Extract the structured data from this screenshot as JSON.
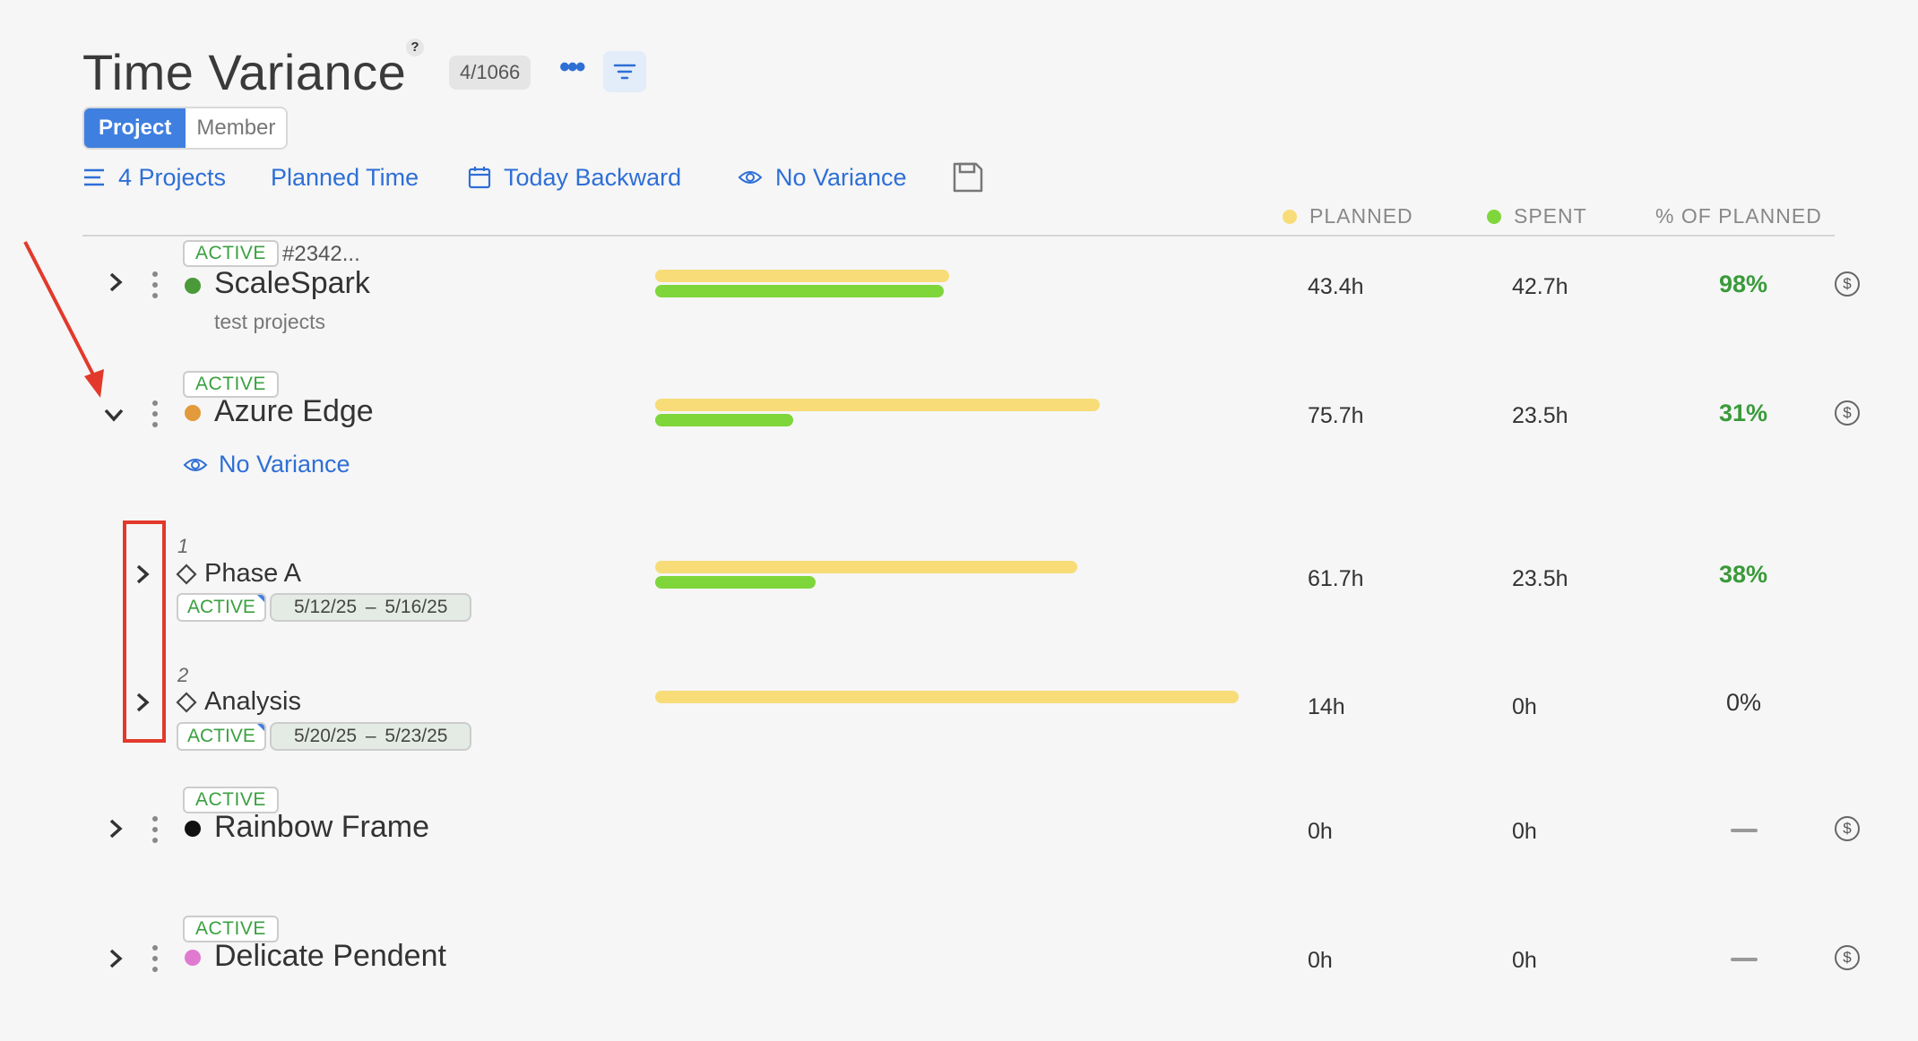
{
  "header": {
    "title": "Time Variance",
    "help_label": "?",
    "count_badge": "4/1066",
    "more_icon": "more-dots-icon",
    "filter_icon": "filter-icon"
  },
  "view_toggle": {
    "project_label": "Project",
    "member_label": "Member",
    "active": "Project"
  },
  "toolbar": {
    "projects_label": "4 Projects",
    "planned_label": "Planned Time",
    "date_label": "Today Backward",
    "variance_label": "No Variance"
  },
  "columns": {
    "planned": "PLANNED",
    "spent": "SPENT",
    "percent": "% OF PLANNED",
    "planned_color": "#f7dc78",
    "spent_color": "#7fd63a"
  },
  "projects": [
    {
      "status": "ACTIVE",
      "code": "#2342...",
      "name": "ScaleSpark",
      "description": "test projects",
      "color": "#4a9a3a",
      "planned": "43.4h",
      "spent": "42.7h",
      "percent": "98%",
      "planned_fraction": 0.51,
      "spent_fraction": 0.5
    },
    {
      "status": "ACTIVE",
      "name": "Azure Edge",
      "variance_label": "No Variance",
      "color": "#e29a3a",
      "planned": "75.7h",
      "spent": "23.5h",
      "percent": "31%",
      "planned_fraction": 0.77,
      "spent_fraction": 0.24,
      "expanded": true,
      "phases": [
        {
          "index": "1",
          "name": "Phase A",
          "status": "ACTIVE",
          "dates": "5/12/25  –  5/16/25",
          "planned": "61.7h",
          "spent": "23.5h",
          "percent": "38%",
          "planned_fraction": 0.73,
          "spent_fraction": 0.28
        },
        {
          "index": "2",
          "name": "Analysis",
          "status": "ACTIVE",
          "dates": "5/20/25  –  5/23/25",
          "planned": "14h",
          "spent": "0h",
          "percent": "0%",
          "planned_fraction": 1.0,
          "spent_fraction": 0
        }
      ]
    },
    {
      "status": "ACTIVE",
      "name": "Rainbow Frame",
      "color": "#111111",
      "planned": "0h",
      "spent": "0h",
      "percent": "—"
    },
    {
      "status": "ACTIVE",
      "name": "Delicate Pendent",
      "color": "#e07ad0",
      "planned": "0h",
      "spent": "0h",
      "percent": "—"
    }
  ]
}
